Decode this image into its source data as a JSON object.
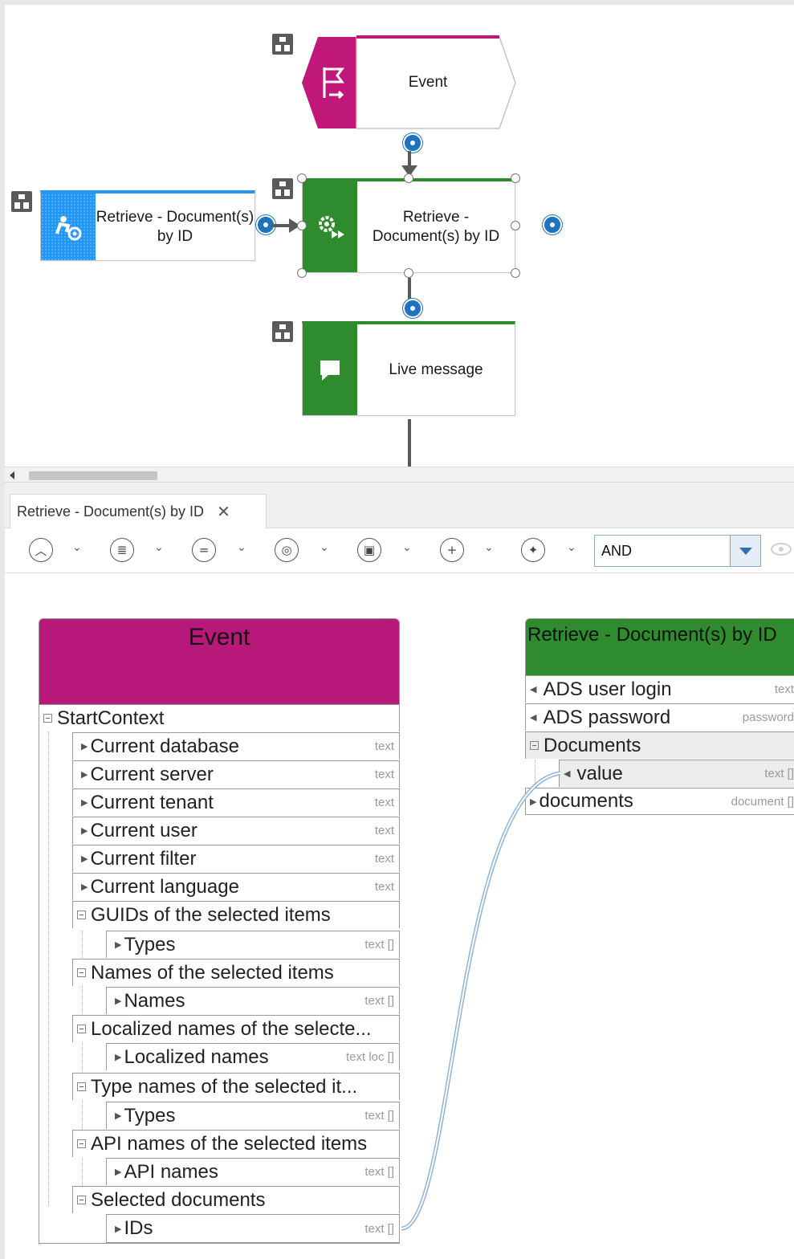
{
  "diagram": {
    "event_label": "Event",
    "function_left_label": "Retrieve - Document(s) by ID",
    "function_center_label": "Retrieve - Document(s) by ID",
    "live_message_label": "Live message",
    "colors": {
      "event": "#c0187a",
      "function_blue": "#2196f3",
      "function_green": "#2e8b2e"
    }
  },
  "panel": {
    "tab_label": "Retrieve - Document(s) by ID",
    "tab_close": "✕",
    "operator_value": "AND"
  },
  "event_table": {
    "title": "Event",
    "root": "StartContext",
    "rows": [
      {
        "label": "Current database",
        "type": "text"
      },
      {
        "label": "Current server",
        "type": "text"
      },
      {
        "label": "Current tenant",
        "type": "text"
      },
      {
        "label": "Current user",
        "type": "text"
      },
      {
        "label": "Current filter",
        "type": "text"
      },
      {
        "label": "Current language",
        "type": "text"
      }
    ],
    "groups": [
      {
        "label": "GUIDs of the selected items",
        "child": "Types",
        "child_type": "text []"
      },
      {
        "label": "Names of the selected items",
        "child": "Names",
        "child_type": "text []"
      },
      {
        "label": "Localized names of the selecte...",
        "child": "Localized names",
        "child_type": "text loc []"
      },
      {
        "label": "Type names of the selected it...",
        "child": "Types",
        "child_type": "text []"
      },
      {
        "label": "API names of the selected items",
        "child": "API names",
        "child_type": "text []"
      },
      {
        "label": "Selected documents",
        "child": "IDs",
        "child_type": "text []"
      }
    ]
  },
  "function_table": {
    "title": "Retrieve - Document(s) by ID",
    "rows": [
      {
        "label": "ADS user login",
        "type": "text"
      },
      {
        "label": "ADS password",
        "type": "password"
      }
    ],
    "group": "Documents",
    "group_child": {
      "label": "value",
      "type": "text []"
    },
    "last": {
      "label": "documents",
      "type": "document []"
    }
  }
}
